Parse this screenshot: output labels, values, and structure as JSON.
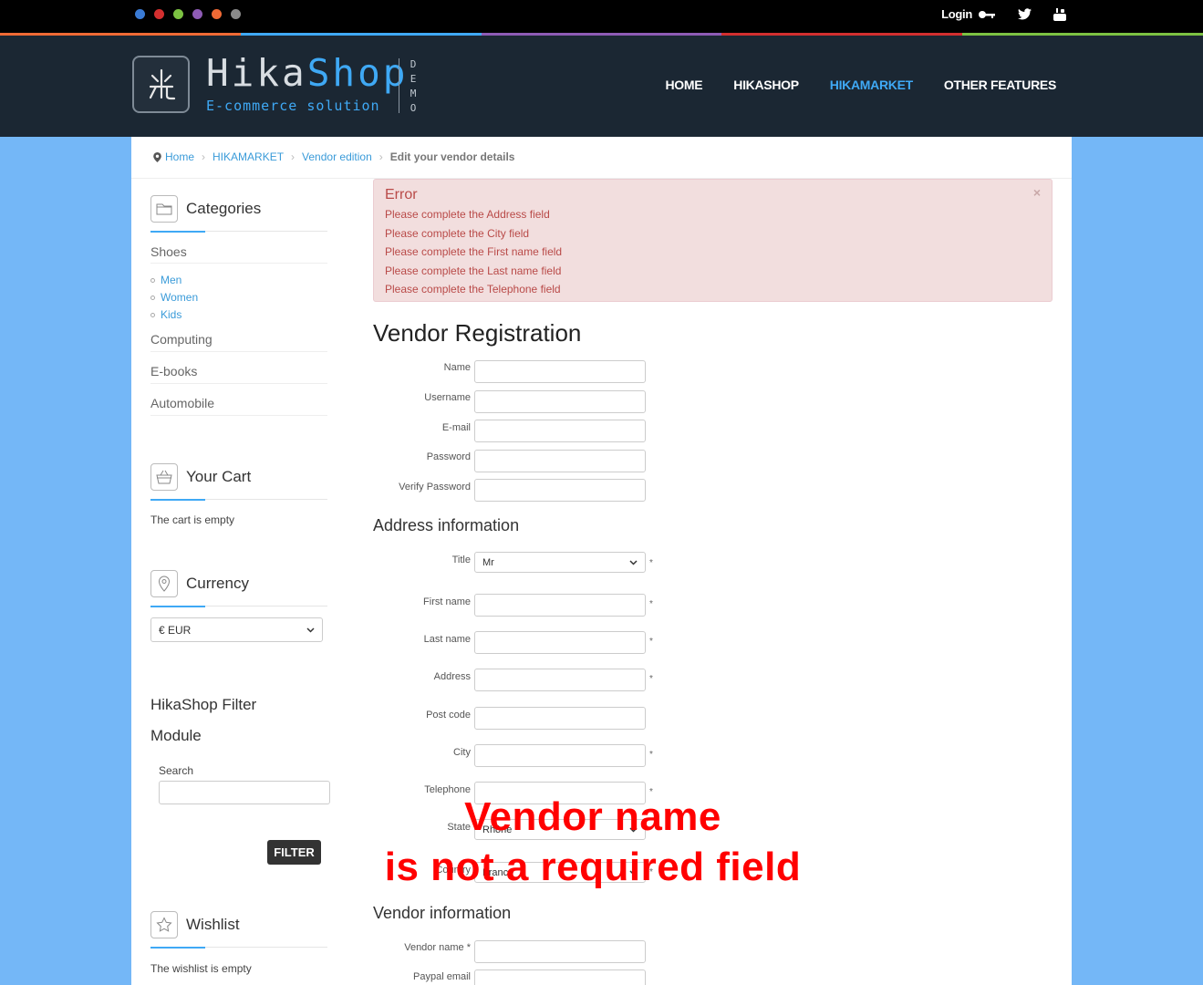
{
  "topbar": {
    "dots": [
      "#3a7bd5",
      "#d32f2f",
      "#7cc242",
      "#8e5bb5",
      "#f06a35",
      "#8a8a8a"
    ],
    "login_label": "Login",
    "social": [
      "twitter-icon",
      "youtube-icon"
    ]
  },
  "colorline": [
    "#f06a35",
    "#3fa9f5",
    "#8e5bb5",
    "#d32f2f",
    "#7cc242"
  ],
  "header": {
    "logo_title_1": "Hika",
    "logo_title_2": "Shop",
    "logo_subtitle": "E-commerce solution",
    "demo": "DEMO",
    "nav": [
      "HOME",
      "HIKASHOP",
      "HIKAMARKET",
      "OTHER FEATURES"
    ],
    "active_nav": "HIKAMARKET"
  },
  "breadcrumb": {
    "home": "Home",
    "items": [
      "HIKAMARKET",
      "Vendor edition"
    ],
    "current": "Edit your vendor details"
  },
  "sidebar": {
    "categories": {
      "title": "Categories",
      "main": "Shoes",
      "subs": [
        "Men",
        "Women",
        "Kids"
      ],
      "others": [
        "Computing",
        "E-books",
        "Automobile"
      ]
    },
    "cart": {
      "title": "Your Cart",
      "empty": "The cart is empty"
    },
    "currency": {
      "title": "Currency",
      "selected": "€ EUR"
    },
    "filter": {
      "title_1": "HikaShop Filter",
      "title_2": "Module",
      "search_label": "Search",
      "button": "FILTER"
    },
    "wishlist": {
      "title": "Wishlist",
      "empty": "The wishlist is empty"
    }
  },
  "error": {
    "title": "Error",
    "close": "×",
    "messages": [
      "Please complete the Address field",
      "Please complete the City field",
      "Please complete the First name field",
      "Please complete the Last name field",
      "Please complete the Telephone field"
    ]
  },
  "form": {
    "title": "Vendor Registration",
    "account_fields": [
      "Name",
      "Username",
      "E-mail",
      "Password",
      "Verify Password"
    ],
    "address_title": "Address information",
    "title_label": "Title",
    "title_value": "Mr",
    "address_fields": [
      "First name",
      "Last name",
      "Address",
      "Post code",
      "City",
      "Telephone"
    ],
    "state_label": "State",
    "state_value": "Rhône",
    "country_label": "Country",
    "country_value": "France",
    "required_mark": "*",
    "vendor_title": "Vendor information",
    "vendor_name_label": "Vendor name *",
    "paypal_label": "Paypal email"
  },
  "annotation": {
    "line1": "Vendor name",
    "line2": "is not a required field"
  }
}
